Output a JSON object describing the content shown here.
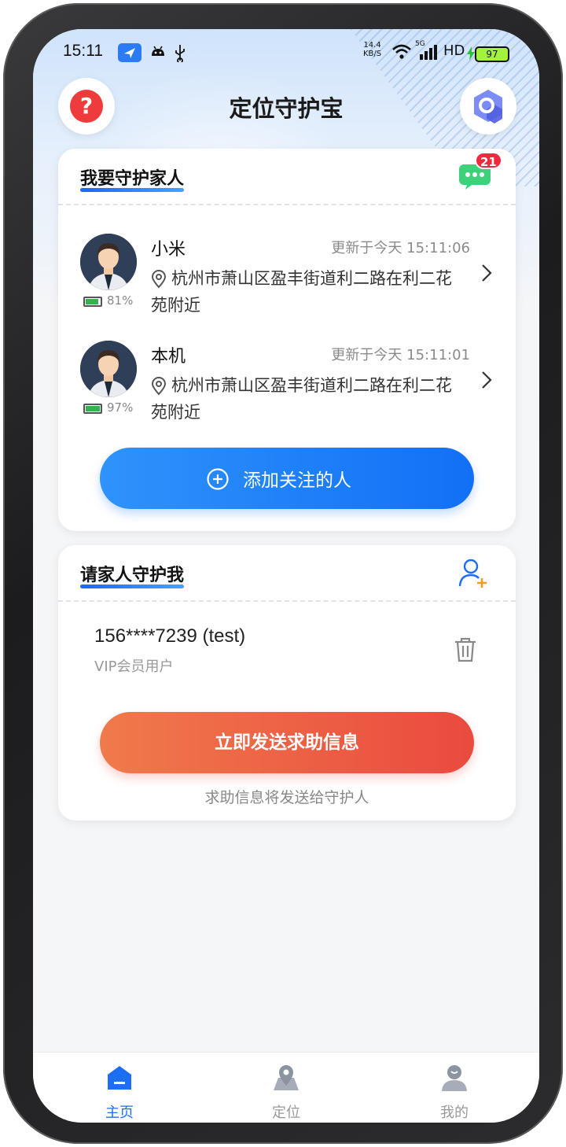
{
  "status_bar": {
    "time": "15:11",
    "net_speed_value": "14.4",
    "net_speed_unit": "KB/S",
    "network_5g": "5G",
    "hd": "HD",
    "battery": "97"
  },
  "header": {
    "title": "定位守护宝"
  },
  "guard_family": {
    "title": "我要守护家人",
    "message_badge": "21",
    "people": [
      {
        "name": "小米",
        "updated": "更新于今天 15:11:06",
        "address": "杭州市萧山区盈丰街道利二路在利二花苑附近",
        "battery": "81%"
      },
      {
        "name": "本机",
        "updated": "更新于今天 15:11:01",
        "address": "杭州市萧山区盈丰街道利二路在利二花苑附近",
        "battery": "97%"
      }
    ],
    "add_button": "添加关注的人"
  },
  "guard_me": {
    "title": "请家人守护我",
    "guardian": {
      "number": "156****7239 (test)",
      "tag": "VIP会员用户"
    },
    "sos_button": "立即发送求助信息",
    "hint": "求助信息将发送给守护人"
  },
  "tabbar": {
    "tabs": [
      {
        "label": "主页",
        "active": true
      },
      {
        "label": "定位",
        "active": false
      },
      {
        "label": "我的",
        "active": false
      }
    ]
  },
  "colors": {
    "primary": "#1c6ff2",
    "danger": "#ea4a3f",
    "badge": "#ef2a3d"
  }
}
